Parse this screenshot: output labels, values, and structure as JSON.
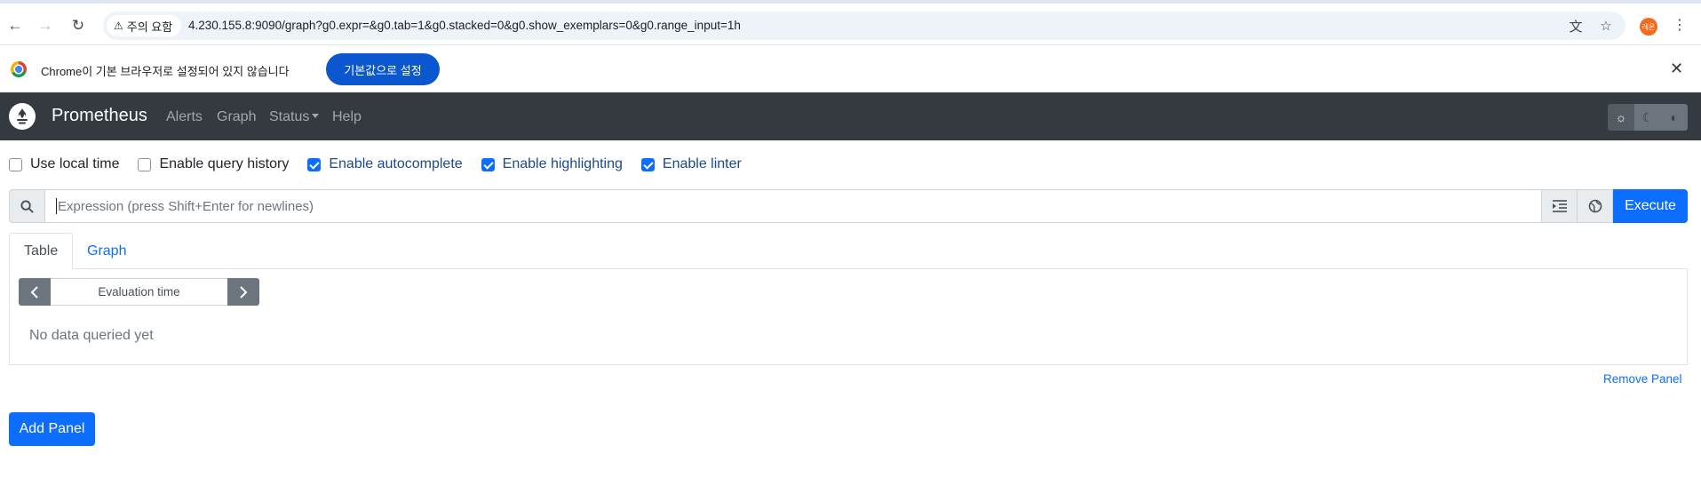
{
  "browser": {
    "security_label": "주의 요함",
    "url": "4.230.155.8:9090/graph?g0.expr=&g0.tab=1&g0.stacked=0&g0.show_exemplars=0&g0.range_input=1h",
    "profile_initials": "레온"
  },
  "infobar": {
    "message": "Chrome이 기본 브라우저로 설정되어 있지 않습니다",
    "button_label": "기본값으로 설정"
  },
  "navbar": {
    "brand": "Prometheus",
    "links": {
      "alerts": "Alerts",
      "graph": "Graph",
      "status": "Status",
      "help": "Help"
    },
    "theme_options": [
      "light",
      "dark",
      "browser-default"
    ],
    "active_theme": "light"
  },
  "options": {
    "use_local_time": {
      "label": "Use local time",
      "checked": false
    },
    "query_history": {
      "label": "Enable query history",
      "checked": false
    },
    "autocomplete": {
      "label": "Enable autocomplete",
      "checked": true
    },
    "highlighting": {
      "label": "Enable highlighting",
      "checked": true
    },
    "linter": {
      "label": "Enable linter",
      "checked": true
    }
  },
  "expression": {
    "placeholder": "Expression (press Shift+Enter for newlines)",
    "value": "",
    "execute_label": "Execute"
  },
  "panel": {
    "tabs": {
      "table": "Table",
      "graph": "Graph"
    },
    "active_tab": "table",
    "eval_time_placeholder": "Evaluation time",
    "no_data": "No data queried yet",
    "remove_label": "Remove Panel"
  },
  "add_panel_label": "Add Panel",
  "colors": {
    "primary": "#0d6efd",
    "navbar_bg": "#343a40",
    "chrome_button": "#0b57d0"
  }
}
